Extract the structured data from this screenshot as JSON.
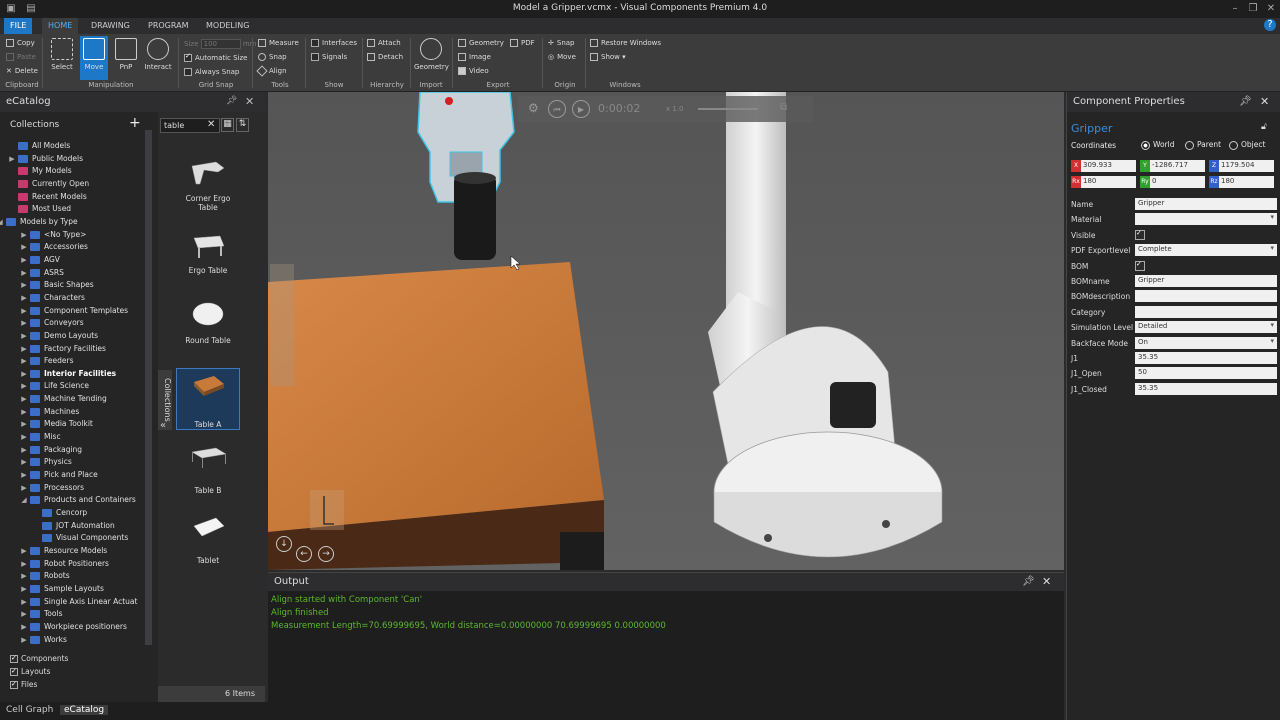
{
  "window": {
    "title": "Model a Gripper.vcmx - Visual Components Premium 4.0"
  },
  "ribbon": {
    "tabs": [
      "FILE",
      "HOME",
      "DRAWING",
      "PROGRAM",
      "MODELING"
    ],
    "clipboard": {
      "copy": "Copy",
      "paste": "Paste",
      "delete": "Delete",
      "label": "Clipboard"
    },
    "manipulation": {
      "select": "Select",
      "move": "Move",
      "pnp": "PnP",
      "interact": "Interact",
      "label": "Manipulation"
    },
    "gridsnap": {
      "size_label": "Size",
      "size_value": "100",
      "size_unit": "mm",
      "automatic_size": "Automatic Size",
      "always_snap": "Always Snap",
      "label": "Grid Snap"
    },
    "tools": {
      "measure": "Measure",
      "snap": "Snap",
      "align": "Align",
      "label": "Tools"
    },
    "show": {
      "interfaces": "Interfaces",
      "signals": "Signals",
      "label": "Show"
    },
    "hierarchy": {
      "attach": "Attach",
      "detach": "Detach",
      "label": "Hierarchy"
    },
    "import": {
      "geometry": "Geometry",
      "label": "Import"
    },
    "export": {
      "geometry": "Geometry",
      "pdf": "PDF",
      "image": "Image",
      "video": "Video",
      "label": "Export"
    },
    "origin": {
      "snap": "Snap",
      "move": "Move",
      "label": "Origin"
    },
    "windows": {
      "restore": "Restore Windows",
      "show": "Show ▾",
      "label": "Windows"
    }
  },
  "ecatalog": {
    "title": "eCatalog",
    "collections_label": "Collections",
    "search_value": "table",
    "tree": [
      {
        "label": "All Models",
        "level": 1,
        "arrow": "",
        "color": "#3a6ec8"
      },
      {
        "label": "Public Models",
        "level": 1,
        "arrow": "▶",
        "color": "#3a6ec8"
      },
      {
        "label": "My Models",
        "level": 1,
        "arrow": "",
        "color": "#c83a6e"
      },
      {
        "label": "Currently Open",
        "level": 1,
        "arrow": "",
        "color": "#c83a6e"
      },
      {
        "label": "Recent Models",
        "level": 1,
        "arrow": "",
        "color": "#c83a6e"
      },
      {
        "label": "Most Used",
        "level": 1,
        "arrow": "",
        "color": "#c83a6e"
      },
      {
        "label": "Models by Type",
        "level": 0,
        "arrow": "◢",
        "color": "#3a6ec8"
      },
      {
        "label": "<No Type>",
        "level": 2,
        "arrow": "▶",
        "color": "#3a6ec8"
      },
      {
        "label": "Accessories",
        "level": 2,
        "arrow": "▶",
        "color": "#3a6ec8"
      },
      {
        "label": "AGV",
        "level": 2,
        "arrow": "▶",
        "color": "#3a6ec8"
      },
      {
        "label": "ASRS",
        "level": 2,
        "arrow": "▶",
        "color": "#3a6ec8"
      },
      {
        "label": "Basic Shapes",
        "level": 2,
        "arrow": "▶",
        "color": "#3a6ec8"
      },
      {
        "label": "Characters",
        "level": 2,
        "arrow": "▶",
        "color": "#3a6ec8"
      },
      {
        "label": "Component Templates",
        "level": 2,
        "arrow": "▶",
        "color": "#3a6ec8"
      },
      {
        "label": "Conveyors",
        "level": 2,
        "arrow": "▶",
        "color": "#3a6ec8"
      },
      {
        "label": "Demo Layouts",
        "level": 2,
        "arrow": "▶",
        "color": "#3a6ec8"
      },
      {
        "label": "Factory Facilities",
        "level": 2,
        "arrow": "▶",
        "color": "#3a6ec8"
      },
      {
        "label": "Feeders",
        "level": 2,
        "arrow": "▶",
        "color": "#3a6ec8"
      },
      {
        "label": "Interior Facilities",
        "level": 2,
        "arrow": "▶",
        "color": "#3a6ec8",
        "bold": true
      },
      {
        "label": "Life Science",
        "level": 2,
        "arrow": "▶",
        "color": "#3a6ec8"
      },
      {
        "label": "Machine Tending",
        "level": 2,
        "arrow": "▶",
        "color": "#3a6ec8"
      },
      {
        "label": "Machines",
        "level": 2,
        "arrow": "▶",
        "color": "#3a6ec8"
      },
      {
        "label": "Media Toolkit",
        "level": 2,
        "arrow": "▶",
        "color": "#3a6ec8"
      },
      {
        "label": "Misc",
        "level": 2,
        "arrow": "▶",
        "color": "#3a6ec8"
      },
      {
        "label": "Packaging",
        "level": 2,
        "arrow": "▶",
        "color": "#3a6ec8"
      },
      {
        "label": "Physics",
        "level": 2,
        "arrow": "▶",
        "color": "#3a6ec8"
      },
      {
        "label": "Pick and Place",
        "level": 2,
        "arrow": "▶",
        "color": "#3a6ec8"
      },
      {
        "label": "Processors",
        "level": 2,
        "arrow": "▶",
        "color": "#3a6ec8"
      },
      {
        "label": "Products and Containers",
        "level": 2,
        "arrow": "◢",
        "color": "#3a6ec8"
      },
      {
        "label": "Cencorp",
        "level": 3,
        "arrow": "",
        "color": "#3a6ec8"
      },
      {
        "label": "JOT Automation",
        "level": 3,
        "arrow": "",
        "color": "#3a6ec8"
      },
      {
        "label": "Visual Components",
        "level": 3,
        "arrow": "",
        "color": "#3a6ec8"
      },
      {
        "label": "Resource Models",
        "level": 2,
        "arrow": "▶",
        "color": "#3a6ec8"
      },
      {
        "label": "Robot Positioners",
        "level": 2,
        "arrow": "▶",
        "color": "#3a6ec8"
      },
      {
        "label": "Robots",
        "level": 2,
        "arrow": "▶",
        "color": "#3a6ec8"
      },
      {
        "label": "Sample Layouts",
        "level": 2,
        "arrow": "▶",
        "color": "#3a6ec8"
      },
      {
        "label": "Single Axis Linear Actuat",
        "level": 2,
        "arrow": "▶",
        "color": "#3a6ec8"
      },
      {
        "label": "Tools",
        "level": 2,
        "arrow": "▶",
        "color": "#3a6ec8"
      },
      {
        "label": "Workpiece positioners",
        "level": 2,
        "arrow": "▶",
        "color": "#3a6ec8"
      },
      {
        "label": "Works",
        "level": 2,
        "arrow": "▶",
        "color": "#3a6ec8"
      }
    ],
    "filters": [
      "Components",
      "Layouts",
      "Files"
    ],
    "results": [
      "Corner Ergo Table",
      "Ergo Table",
      "Round Table",
      "Table A",
      "Table B",
      "Tablet"
    ],
    "collections_tab": "Collections",
    "count": "6 Items"
  },
  "bottom_tabs": [
    "Cell Graph",
    "eCatalog"
  ],
  "simulation": {
    "time": "0:00:02",
    "speed": "x 1.0"
  },
  "output": {
    "title": "Output",
    "lines": [
      "Align started with Component 'Can'",
      "Align finished",
      "Measurement Length=70.69999695, World distance=0.00000000 70.69999695 0.00000000"
    ]
  },
  "properties": {
    "title": "Component Properties",
    "component_name": "Gripper",
    "coordinates_label": "Coordinates",
    "coord_modes": [
      "World",
      "Parent",
      "Object"
    ],
    "x": "309.933",
    "y": "-1286.717",
    "z": "1179.504",
    "rx": "180",
    "ry": "0",
    "rz": "180",
    "rows": [
      {
        "label": "Name",
        "value": "Gripper",
        "type": "text"
      },
      {
        "label": "Material",
        "value": "",
        "type": "dropdown"
      },
      {
        "label": "Visible",
        "value": "",
        "type": "check"
      },
      {
        "label": "PDF Exportlevel",
        "value": "Complete",
        "type": "dropdown"
      },
      {
        "label": "BOM",
        "value": "",
        "type": "check"
      },
      {
        "label": "BOMname",
        "value": "Gripper",
        "type": "text"
      },
      {
        "label": "BOMdescription",
        "value": "",
        "type": "text"
      },
      {
        "label": "Category",
        "value": "",
        "type": "text"
      },
      {
        "label": "Simulation Level",
        "value": "Detailed",
        "type": "dropdown"
      },
      {
        "label": "Backface Mode",
        "value": "On",
        "type": "dropdown"
      },
      {
        "label": "J1",
        "value": "35.35",
        "type": "text"
      },
      {
        "label": "J1_Open",
        "value": "50",
        "type": "text"
      },
      {
        "label": "J1_Closed",
        "value": "35.35",
        "type": "text"
      }
    ]
  },
  "colors": {
    "accent": "#1e78c8",
    "output_text": "#5cb82c",
    "table_wood": "#c87a3a",
    "gripper_outline": "#3cc8e8"
  }
}
